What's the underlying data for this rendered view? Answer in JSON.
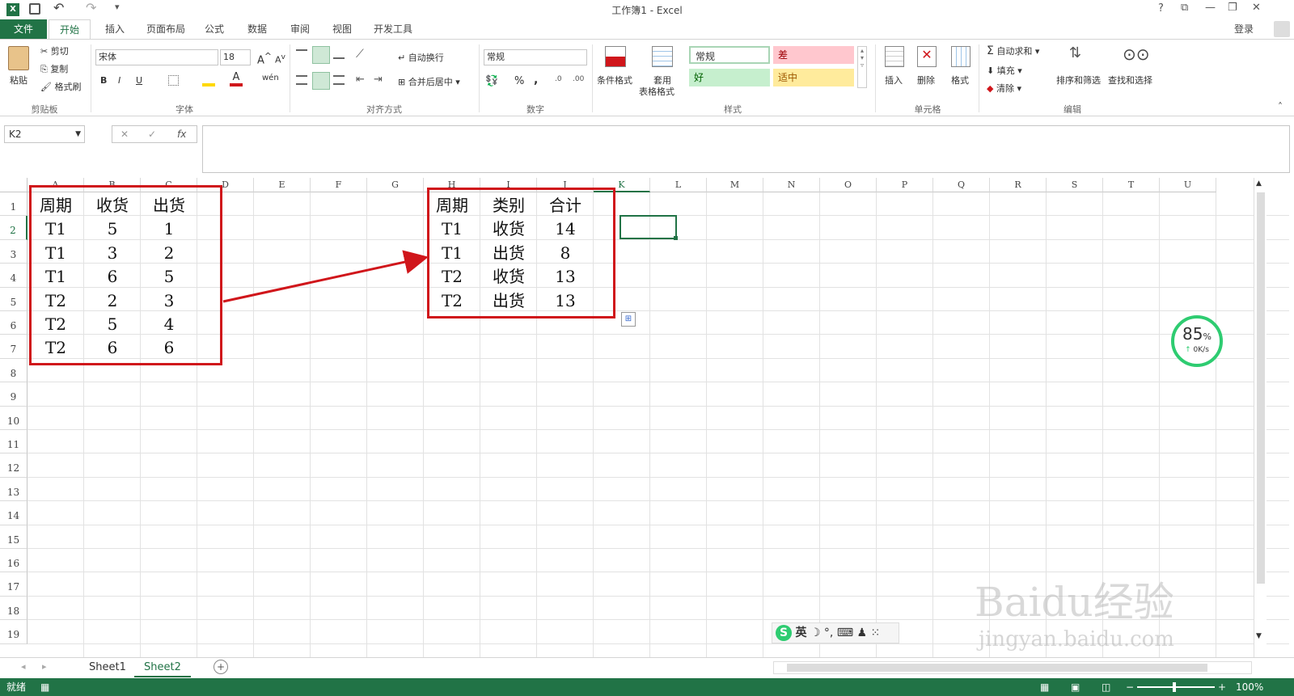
{
  "title": "工作簿1 - Excel",
  "window_controls": {
    "help": "?",
    "ribbon_display": "⧉",
    "minimize": "—",
    "restore": "❐",
    "close": "✕"
  },
  "tabs": [
    "文件",
    "开始",
    "插入",
    "页面布局",
    "公式",
    "数据",
    "审阅",
    "视图",
    "开发工具"
  ],
  "signin": "登录",
  "ribbon": {
    "clipboard": {
      "paste": "粘贴",
      "cut": "剪切",
      "copy": "复制",
      "painter": "格式刷",
      "label": "剪贴板"
    },
    "font": {
      "name": "宋体",
      "size": "18",
      "label": "字体",
      "bold": "B",
      "italic": "I",
      "underline": "U"
    },
    "alignment": {
      "wrap": "自动换行",
      "merge": "合并后居中",
      "label": "对齐方式"
    },
    "number": {
      "format": "常规",
      "percent": "%",
      "comma": ",",
      "label": "数字"
    },
    "styles": {
      "cond": "条件格式",
      "table1": "套用",
      "table2": "表格格式",
      "normal": "常规",
      "bad": "差",
      "good": "好",
      "neutral": "适中",
      "label": "样式"
    },
    "cells": {
      "insert": "插入",
      "delete": "删除",
      "format": "格式",
      "label": "单元格"
    },
    "editing": {
      "autosum": "自动求和",
      "fill": "填充",
      "clear": "清除",
      "sort": "排序和筛选",
      "find": "查找和选择",
      "label": "编辑"
    }
  },
  "namebox": "K2",
  "fx": "fx",
  "columns": [
    "A",
    "B",
    "C",
    "D",
    "E",
    "F",
    "G",
    "H",
    "I",
    "J",
    "K",
    "L",
    "M",
    "N",
    "O",
    "P",
    "Q",
    "R",
    "S",
    "T",
    "U"
  ],
  "rows": [
    "1",
    "2",
    "3",
    "4",
    "5",
    "6",
    "7",
    "8",
    "9",
    "10",
    "11",
    "12",
    "13",
    "14",
    "15",
    "16",
    "17",
    "18",
    "19"
  ],
  "table_left": {
    "header": [
      "周期",
      "收货",
      "出货"
    ],
    "rows": [
      [
        "T1",
        "5",
        "1"
      ],
      [
        "T1",
        "3",
        "2"
      ],
      [
        "T1",
        "6",
        "5"
      ],
      [
        "T2",
        "2",
        "3"
      ],
      [
        "T2",
        "5",
        "4"
      ],
      [
        "T2",
        "6",
        "6"
      ]
    ]
  },
  "table_right": {
    "header": [
      "周期",
      "类别",
      "合计"
    ],
    "rows": [
      [
        "T1",
        "收货",
        "14"
      ],
      [
        "T1",
        "出货",
        "8"
      ],
      [
        "T2",
        "收货",
        "13"
      ],
      [
        "T2",
        "出货",
        "13"
      ]
    ]
  },
  "speed_widget": {
    "percent": "85",
    "unit": "%",
    "speed": "0K/s"
  },
  "ime": {
    "lang": "英"
  },
  "sheets": [
    "Sheet1",
    "Sheet2"
  ],
  "status": {
    "ready": "就绪",
    "zoom": "100%"
  },
  "watermark": {
    "brand": "Baidu经验",
    "url": "jingyan.baidu.com"
  },
  "colors": {
    "excel_green": "#217346",
    "red_box": "#d0161b"
  }
}
